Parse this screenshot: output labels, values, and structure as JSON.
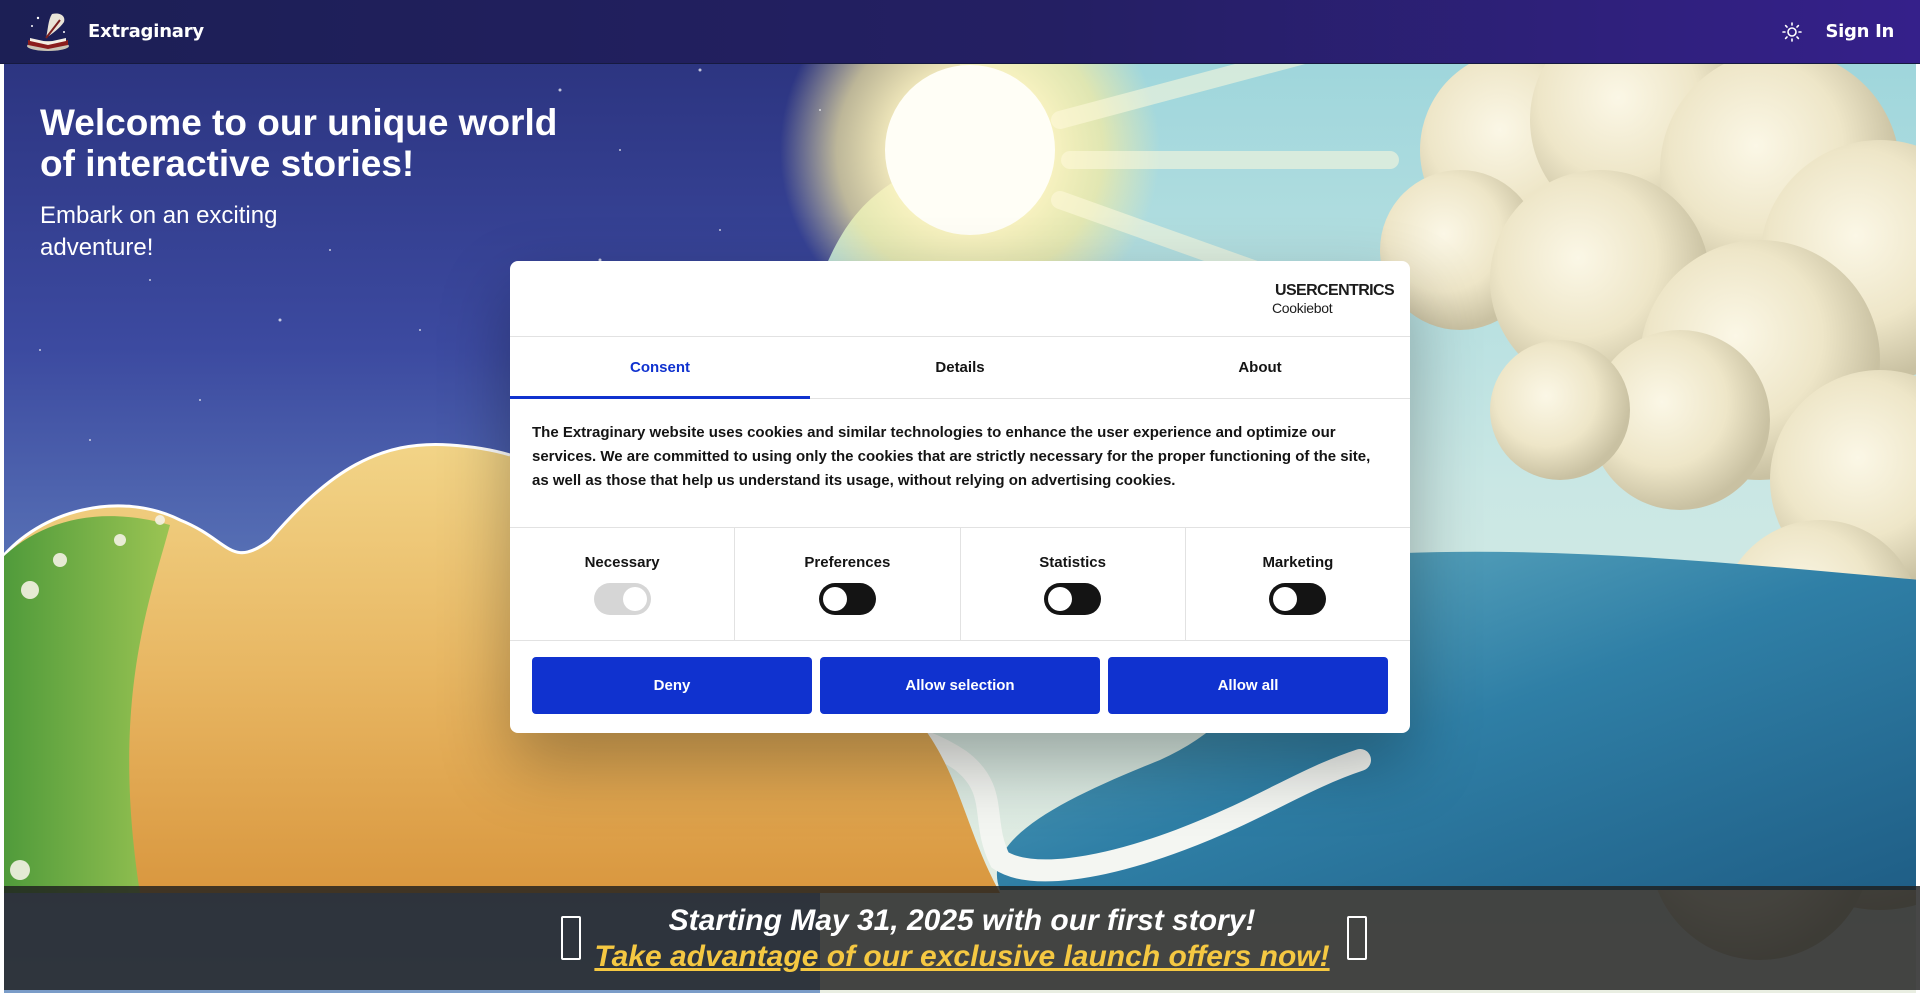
{
  "nav": {
    "brand": "Extraginary",
    "signin": "Sign In",
    "logo_icon": "book-quill-icon",
    "theme_icon": "sun-icon"
  },
  "hero": {
    "title": "Welcome to our unique world of interactive stories!",
    "subtitle": "Embark on an exciting adventure!"
  },
  "dialog": {
    "provider_line1": "USERCENTRICS",
    "provider_line2": "Cookiebot",
    "tabs": [
      {
        "label": "Consent",
        "active": true
      },
      {
        "label": "Details",
        "active": false
      },
      {
        "label": "About",
        "active": false
      }
    ],
    "body": "The Extraginary website uses cookies and similar technologies to enhance the user experience and optimize our services. We are committed to using only the cookies that are strictly necessary for the proper functioning of the site, as well as those that help us understand its usage, without relying on advertising cookies.",
    "categories": [
      {
        "label": "Necessary",
        "enabled": true,
        "locked": true
      },
      {
        "label": "Preferences",
        "enabled": false,
        "locked": false
      },
      {
        "label": "Statistics",
        "enabled": false,
        "locked": false
      },
      {
        "label": "Marketing",
        "enabled": false,
        "locked": false
      }
    ],
    "buttons": {
      "deny": "Deny",
      "allow_selection": "Allow selection",
      "allow_all": "Allow all"
    },
    "accent_color": "#1032cf"
  },
  "banner": {
    "line1": "Starting May 31, 2025 with our first story!",
    "line2": "Take advantage of our exclusive launch offers now!",
    "link_color": "#f5c842"
  }
}
